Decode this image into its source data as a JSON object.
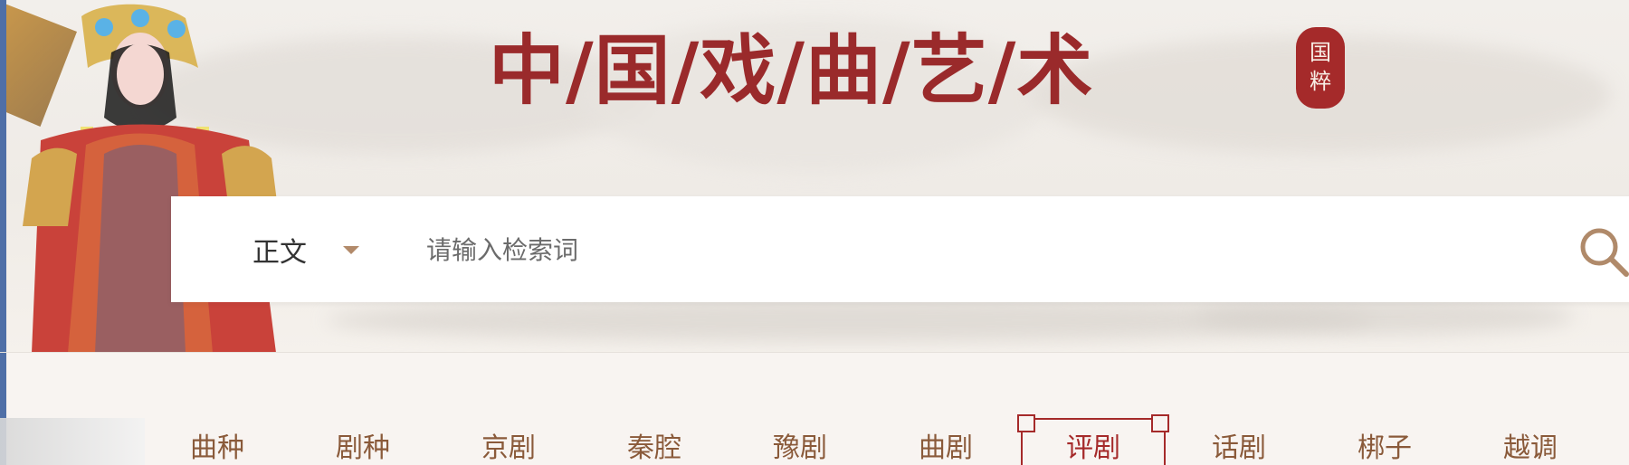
{
  "header": {
    "title": "中/国/戏/曲/艺/术",
    "seal_text": "国粹"
  },
  "search": {
    "scope_label": "正文",
    "placeholder": "请输入检索词",
    "value": ""
  },
  "nav": {
    "items": [
      {
        "label": "曲种"
      },
      {
        "label": "剧种"
      },
      {
        "label": "京剧"
      },
      {
        "label": "秦腔"
      },
      {
        "label": "豫剧"
      },
      {
        "label": "曲剧"
      },
      {
        "label": "评剧"
      },
      {
        "label": "话剧"
      },
      {
        "label": "梆子"
      },
      {
        "label": "越调"
      }
    ],
    "active_label": "评剧"
  },
  "icons": {
    "search": "search-icon",
    "dropdown": "caret-down-icon"
  },
  "colors": {
    "accent": "#9a2a2b",
    "nav_text": "#8a5a3a",
    "background": "#f8f4f1"
  }
}
